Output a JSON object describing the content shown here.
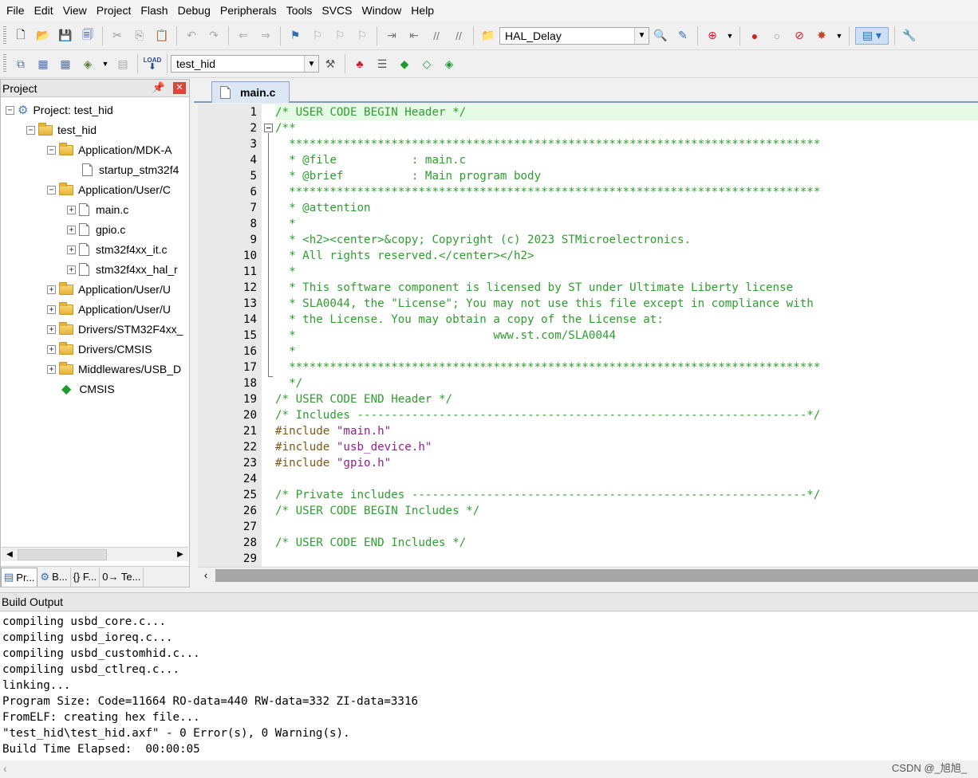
{
  "menu": [
    "File",
    "Edit",
    "View",
    "Project",
    "Flash",
    "Debug",
    "Peripherals",
    "Tools",
    "SVCS",
    "Window",
    "Help"
  ],
  "toolbar1": {
    "find_combo_value": "HAL_Delay"
  },
  "toolbar2": {
    "target_combo_value": "test_hid",
    "load_label": "LOAD"
  },
  "project_panel": {
    "title": "Project",
    "tree": [
      {
        "label": "Project: test_hid"
      },
      {
        "label": "test_hid"
      },
      {
        "label": "Application/MDK-A"
      },
      {
        "label": "startup_stm32f4"
      },
      {
        "label": "Application/User/C"
      },
      {
        "label": "main.c"
      },
      {
        "label": "gpio.c"
      },
      {
        "label": "stm32f4xx_it.c"
      },
      {
        "label": "stm32f4xx_hal_r"
      },
      {
        "label": "Application/User/U"
      },
      {
        "label": "Application/User/U"
      },
      {
        "label": "Drivers/STM32F4xx_"
      },
      {
        "label": "Drivers/CMSIS"
      },
      {
        "label": "Middlewares/USB_D"
      },
      {
        "label": "CMSIS"
      }
    ],
    "tabs": [
      "Pr...",
      "B...",
      "{} F...",
      "0→ Te..."
    ]
  },
  "editor": {
    "active_tab": "main.c",
    "lines": [
      {
        "n": "1",
        "t": "/* USER CODE BEGIN Header */",
        "k": "cm"
      },
      {
        "n": "2",
        "t": "/**",
        "k": "cm"
      },
      {
        "n": "3",
        "t": "  ******************************************************************************",
        "k": "cm"
      },
      {
        "n": "4",
        "t": "  * @file           : main.c",
        "k": "cm"
      },
      {
        "n": "5",
        "t": "  * @brief          : Main program body",
        "k": "cm"
      },
      {
        "n": "6",
        "t": "  ******************************************************************************",
        "k": "cm"
      },
      {
        "n": "7",
        "t": "  * @attention",
        "k": "cm"
      },
      {
        "n": "8",
        "t": "  *",
        "k": "cm"
      },
      {
        "n": "9",
        "t": "  * <h2><center>&copy; Copyright (c) 2023 STMicroelectronics.",
        "k": "cm"
      },
      {
        "n": "10",
        "t": "  * All rights reserved.</center></h2>",
        "k": "cm"
      },
      {
        "n": "11",
        "t": "  *",
        "k": "cm"
      },
      {
        "n": "12",
        "t": "  * This software component is licensed by ST under Ultimate Liberty license",
        "k": "cm"
      },
      {
        "n": "13",
        "t": "  * SLA0044, the \"License\"; You may not use this file except in compliance with",
        "k": "cm"
      },
      {
        "n": "14",
        "t": "  * the License. You may obtain a copy of the License at:",
        "k": "cm"
      },
      {
        "n": "15",
        "t": "  *                             www.st.com/SLA0044",
        "k": "cm"
      },
      {
        "n": "16",
        "t": "  *",
        "k": "cm"
      },
      {
        "n": "17",
        "t": "  ******************************************************************************",
        "k": "cm"
      },
      {
        "n": "18",
        "t": "  */",
        "k": "cm"
      },
      {
        "n": "19",
        "t": "/* USER CODE END Header */",
        "k": "cm"
      },
      {
        "n": "20",
        "t": "/* Includes ------------------------------------------------------------------*/",
        "k": "cm"
      },
      {
        "n": "21",
        "pp": "#include ",
        "st": "\"main.h\""
      },
      {
        "n": "22",
        "pp": "#include ",
        "st": "\"usb_device.h\""
      },
      {
        "n": "23",
        "pp": "#include ",
        "st": "\"gpio.h\""
      },
      {
        "n": "24",
        "t": "",
        "k": "cm"
      },
      {
        "n": "25",
        "t": "/* Private includes ----------------------------------------------------------*/",
        "k": "cm"
      },
      {
        "n": "26",
        "t": "/* USER CODE BEGIN Includes */",
        "k": "cm"
      },
      {
        "n": "27",
        "t": "",
        "k": "cm"
      },
      {
        "n": "28",
        "t": "/* USER CODE END Includes */",
        "k": "cm"
      },
      {
        "n": "29",
        "t": "",
        "k": "cm"
      }
    ]
  },
  "build_output": {
    "title": "Build Output",
    "lines": [
      "compiling usbd_core.c...",
      "compiling usbd_ioreq.c...",
      "compiling usbd_customhid.c...",
      "compiling usbd_ctlreq.c...",
      "linking...",
      "Program Size: Code=11664 RO-data=440 RW-data=332 ZI-data=3316",
      "FromELF: creating hex file...",
      "\"test_hid\\test_hid.axf\" - 0 Error(s), 0 Warning(s).",
      "Build Time Elapsed:  00:00:05"
    ]
  },
  "watermark": "CSDN @_旭旭_"
}
